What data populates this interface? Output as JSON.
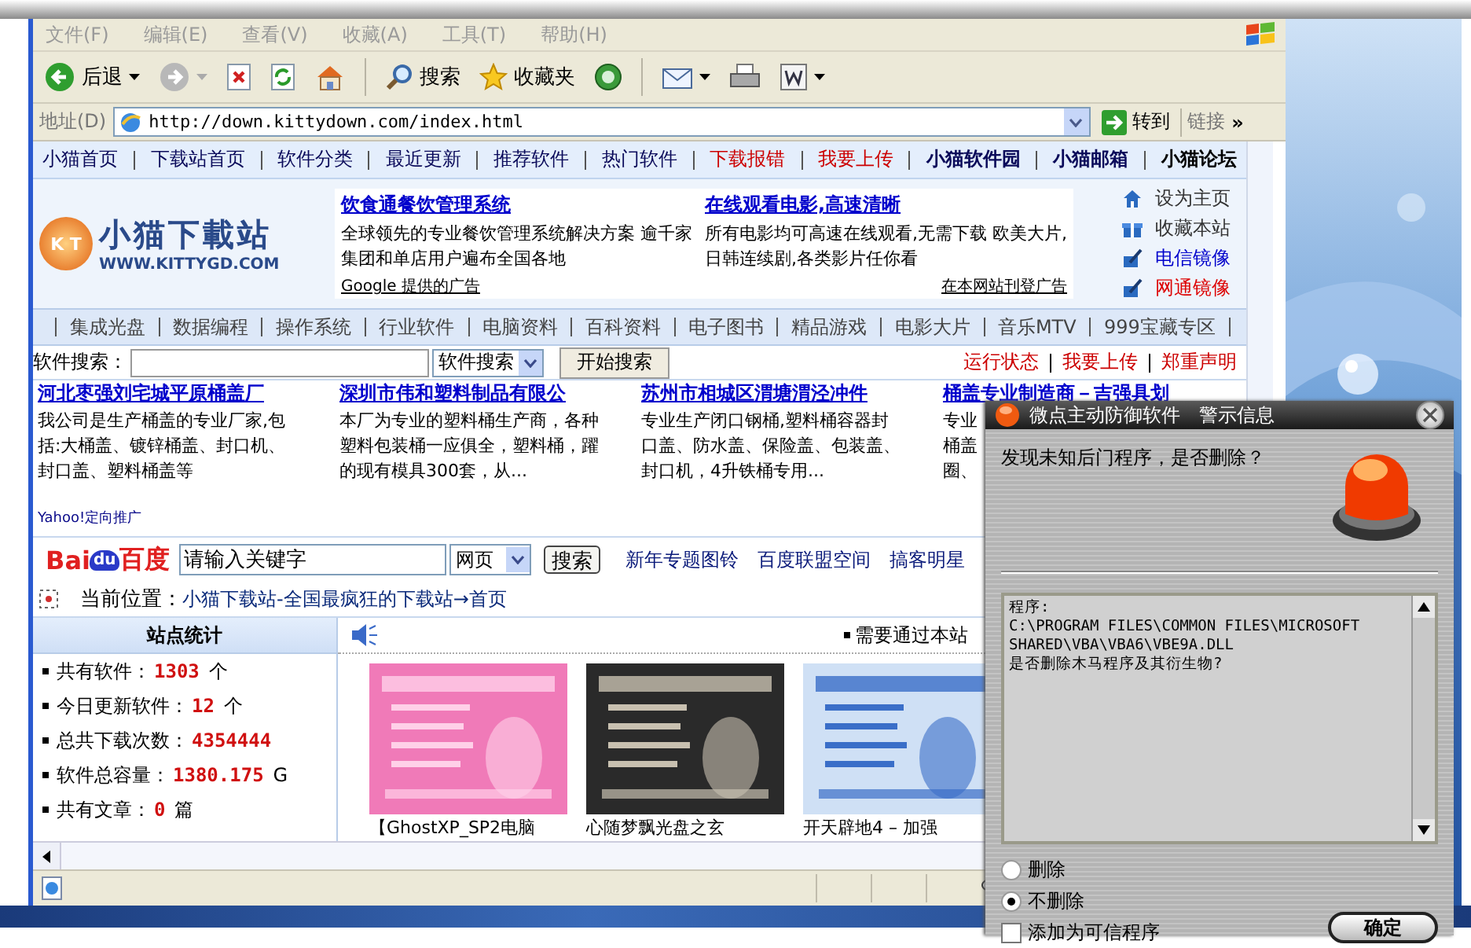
{
  "menu": [
    "文件(F)",
    "编辑(E)",
    "查看(V)",
    "收藏(A)",
    "工具(T)",
    "帮助(H)"
  ],
  "toolbar": [
    {
      "kind": "back",
      "label": "后退"
    },
    {
      "kind": "forward"
    },
    {
      "kind": "stop"
    },
    {
      "kind": "refresh"
    },
    {
      "kind": "home"
    },
    {
      "kind": "search",
      "label": "搜索"
    },
    {
      "kind": "favorites",
      "label": "收藏夹"
    },
    {
      "kind": "media"
    },
    {
      "kind": "mail"
    },
    {
      "kind": "print"
    },
    {
      "kind": "word"
    }
  ],
  "address": {
    "label": "地址(D)",
    "url": "http://down.kittydown.com/index.html",
    "go": "转到",
    "links": "链接",
    "more": "»"
  },
  "nav": [
    {
      "label": "小猫首页",
      "color": "#0a0a5a",
      "bold": false
    },
    {
      "label": "下载站首页",
      "color": "#0a0a5a",
      "bold": false
    },
    {
      "label": "软件分类",
      "color": "#0a0a5a",
      "bold": false
    },
    {
      "label": "最近更新",
      "color": "#0a0a5a",
      "bold": false
    },
    {
      "label": "推荐软件",
      "color": "#0a0a5a",
      "bold": false
    },
    {
      "label": "热门软件",
      "color": "#0a0a5a",
      "bold": false
    },
    {
      "label": "下载报错",
      "color": "#cc0000",
      "bold": false
    },
    {
      "label": "我要上传",
      "color": "#cc0000",
      "bold": false
    },
    {
      "label": "小猫软件园",
      "color": "#0a0a5a",
      "bold": true
    },
    {
      "label": "小猫邮箱",
      "color": "#0a0a5a",
      "bold": true
    },
    {
      "label": "小猫论坛",
      "color": "#000000",
      "bold": true
    }
  ],
  "header": {
    "logo": {
      "badge": "K T",
      "title": "小猫下載站",
      "url": "WWW.KITTYGD.COM"
    },
    "ads": [
      {
        "title": "饮食通餐饮管理系统",
        "lines": [
          "全球领先的专业餐饮管理系统解决方案 逾千家",
          "集团和单店用户遍布全国各地"
        ]
      },
      {
        "title": "在线观看电影,高速清晰",
        "lines": [
          "所有电影均可高速在线观看,无需下载 欧美大片,",
          "日韩连续剧,各类影片任你看"
        ]
      }
    ],
    "ad_credit": "Google 提供的广告",
    "ad_place": "在本网站刊登广告",
    "links": [
      {
        "kind": "home",
        "label": "设为主页",
        "color": "#333333"
      },
      {
        "kind": "favorite",
        "label": "收藏本站",
        "color": "#333333"
      },
      {
        "kind": "mirror",
        "label": "电信镜像",
        "color": "#0000cc"
      },
      {
        "kind": "mirror",
        "label": "网通镜像",
        "color": "#dd0000"
      }
    ]
  },
  "categories": [
    "集成光盘",
    "数据编程",
    "操作系统",
    "行业软件",
    "电脑资料",
    "百科资料",
    "电子图书",
    "精品游戏",
    "电影大片",
    "音乐MTV",
    "999宝藏专区"
  ],
  "search": {
    "label": "软件搜索：",
    "select": "软件搜索",
    "button": "开始搜索",
    "links": [
      "运行状态",
      "我要上传",
      "郑重声明"
    ]
  },
  "text_ads": [
    {
      "title": "河北枣强刘宅城平原桶盖厂",
      "lines": [
        "我公司是生产桶盖的专业厂家,包",
        "括:大桶盖、镀锌桶盖、封口机、",
        "封口盖、塑料桶盖等"
      ]
    },
    {
      "title": "深圳市伟和塑料制品有限公",
      "lines": [
        "本厂为专业的塑料桶生产商，各种",
        "塑料包装桶一应俱全，塑料桶，躍",
        "的现有模具300套，从..."
      ]
    },
    {
      "title": "苏州市相城区渭塘渭泾冲件",
      "lines": [
        "专业生产闭口钢桶,塑料桶容器封",
        "口盖、防水盖、保险盖、包装盖、",
        "封口机，4升铁桶专用..."
      ]
    },
    {
      "title": "桶盖专业制造商－吉强具划",
      "lines": [
        "专业",
        "桶盖",
        "圈、"
      ]
    }
  ],
  "text_ads_credit": "Yahoo!定向推广",
  "baidu": {
    "logo": [
      "Bai",
      "du",
      "百度"
    ],
    "value": "请输入关键字",
    "select": "网页",
    "button": "搜索",
    "links": [
      "新年专题图铃",
      "百度联盟空间",
      "搞客明星"
    ]
  },
  "breadcrumb": {
    "label": "当前位置：",
    "path": "小猫下载站-全国最疯狂的下载站→首页"
  },
  "stats": {
    "title": "站点统计",
    "items": [
      {
        "label": "共有软件：",
        "value": "1303",
        "unit": "个"
      },
      {
        "label": "今日更新软件：",
        "value": "12",
        "unit": "个"
      },
      {
        "label": "总共下载次数：",
        "value": "4354444"
      },
      {
        "label": "软件总容量：",
        "value": "1380.175",
        "unit": "G"
      },
      {
        "label": "共有文章：",
        "value": "0",
        "unit": "篇"
      }
    ]
  },
  "notice": "需要通过本站",
  "thumbs": [
    {
      "kind": "picture",
      "caption": "【GhostXP_SP2电脑"
    },
    {
      "kind": "picture",
      "caption": "心随梦飘光盘之玄"
    },
    {
      "kind": "picture",
      "caption": "开天辟地4 – 加强"
    }
  ],
  "dialog": {
    "title": "微点主动防御软件　警示信息",
    "question": "发现未知后门程序，是否删除？",
    "details": [
      "程序:",
      "C:\\PROGRAM FILES\\COMMON FILES\\MICROSOFT",
      "SHARED\\VBA\\VBA6\\VBE9A.DLL",
      "是否删除木马程序及其衍生物?"
    ],
    "options": [
      {
        "label": "删除",
        "selected": false
      },
      {
        "label": "不删除",
        "selected": true
      }
    ],
    "trusted": {
      "label": "添加为可信程序",
      "checked": false
    },
    "ok": "确定"
  }
}
